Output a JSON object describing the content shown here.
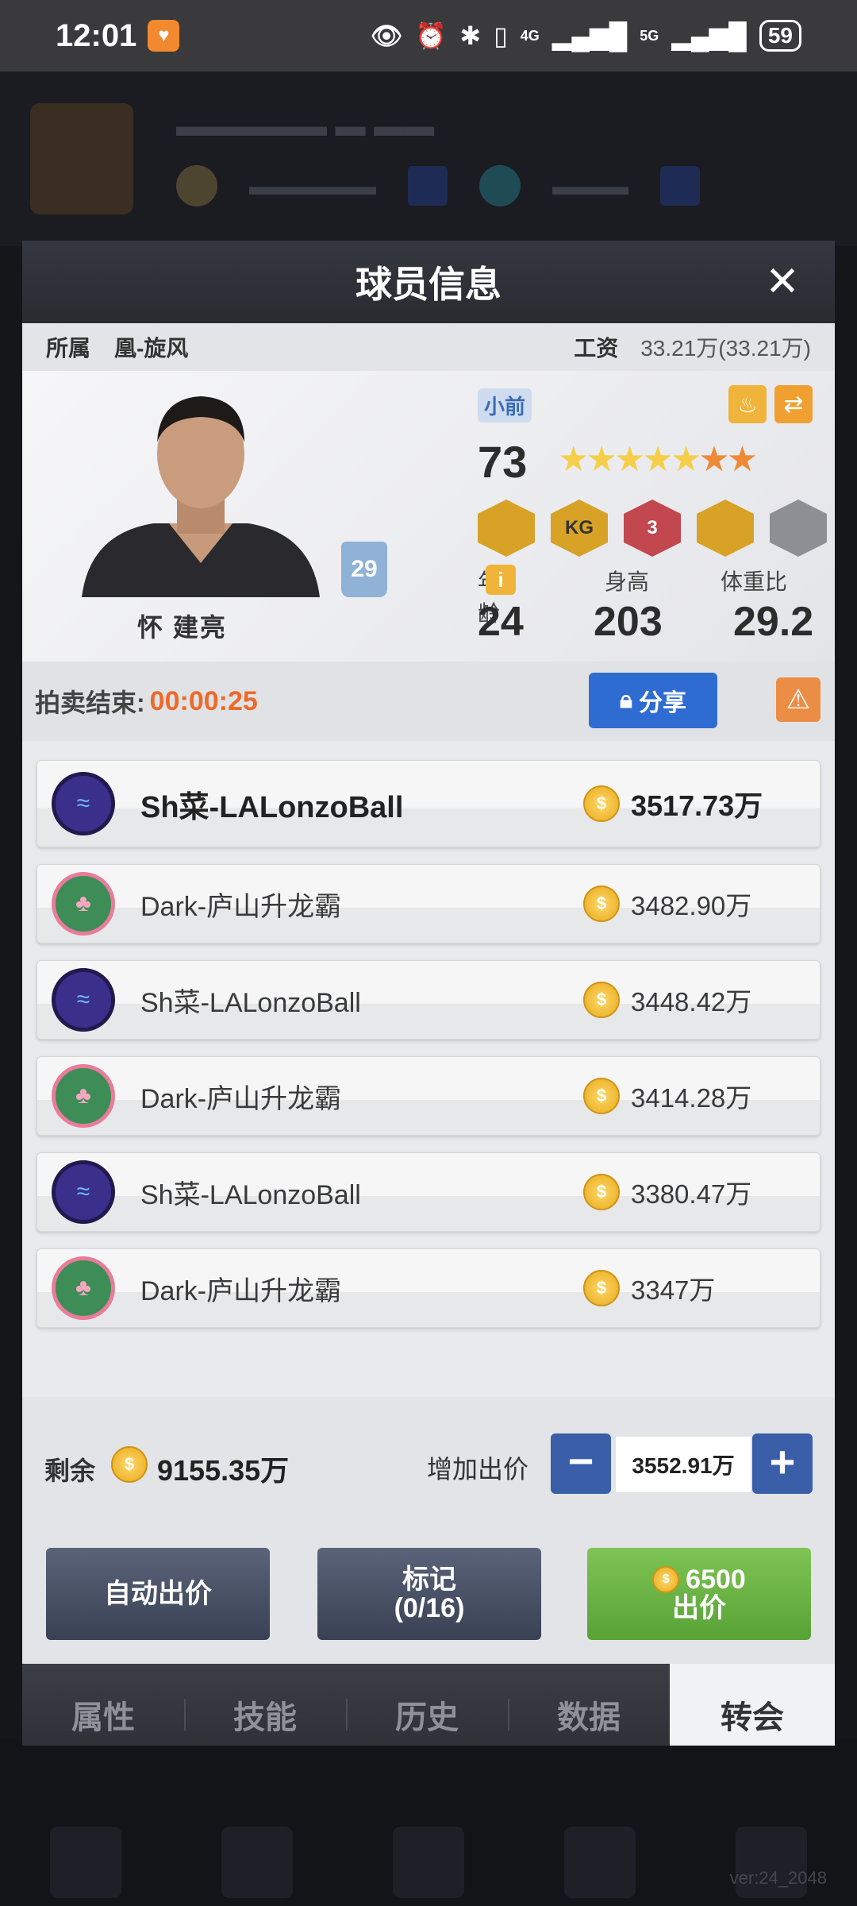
{
  "status_bar": {
    "time": "12:01",
    "net_4g": "4G",
    "net_5g": "5G",
    "battery": "59"
  },
  "dialog": {
    "title": "球员信息",
    "team_label": "所属",
    "team_value": "凰-旋风",
    "salary_label": "工资",
    "salary_value": "33.21万(33.21万)"
  },
  "player": {
    "name": "怀 建亮",
    "jersey": "29",
    "position": "小前",
    "rating": "73",
    "stars_total": 7,
    "stars_gold": 5,
    "badges": [
      "",
      "KG",
      "3",
      "",
      ""
    ],
    "age_label": "年龄",
    "height_label": "身高",
    "weight_label": "体重比",
    "age": "24",
    "height": "203",
    "weight": "29.2"
  },
  "auction": {
    "label": "拍卖结束:",
    "timer": "00:00:25",
    "share_label": "分享"
  },
  "bids": [
    {
      "bidder": "Sh菜-LALonzoBall",
      "amount": "3517.73万",
      "team": "sh"
    },
    {
      "bidder": "Dark-庐山升龙霸",
      "amount": "3482.90万",
      "team": "dk"
    },
    {
      "bidder": "Sh菜-LALonzoBall",
      "amount": "3448.42万",
      "team": "sh"
    },
    {
      "bidder": "Dark-庐山升龙霸",
      "amount": "3414.28万",
      "team": "dk"
    },
    {
      "bidder": "Sh菜-LALonzoBall",
      "amount": "3380.47万",
      "team": "sh"
    },
    {
      "bidder": "Dark-庐山升龙霸",
      "amount": "3347万",
      "team": "dk"
    }
  ],
  "balance": {
    "label": "剩余",
    "value": "9155.35万",
    "increase_label": "增加出价",
    "bid_value": "3552.91万"
  },
  "actions": {
    "auto_bid": "自动出价",
    "mark_line1": "标记",
    "mark_line2": "(0/16)",
    "bid_cost": "6500",
    "bid_label": "出价"
  },
  "tabs": [
    "属性",
    "技能",
    "历史",
    "数据",
    "转会"
  ],
  "active_tab": 4,
  "version": "ver:24_2048",
  "colors": {
    "accent_blue": "#2f6cd2",
    "timer_orange": "#ec6a2a",
    "bid_green": "#6fb645"
  }
}
